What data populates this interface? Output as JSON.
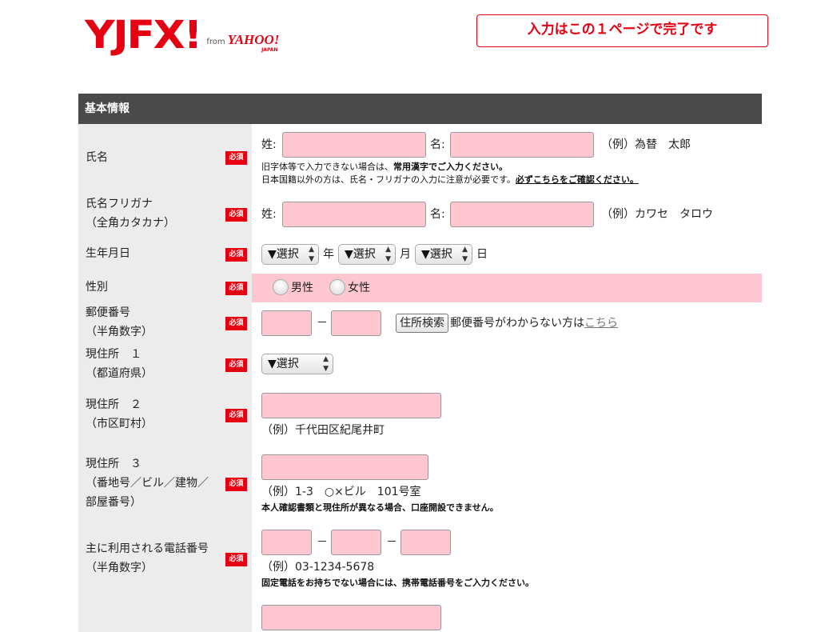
{
  "header": {
    "logo_text": "YJFX!",
    "logo_from": "from",
    "logo_yahoo": "YAHOO!",
    "logo_japan": "JAPAN",
    "banner": "入力はこの１ページで完了です"
  },
  "section_title": "基本情報",
  "required_badge": "必須",
  "fields": {
    "name": {
      "label": "氏名",
      "last_prefix": "姓:",
      "first_prefix": "名:",
      "example": "（例）為替　太郎",
      "note1_plain": "旧字体等で入力できない場合は、",
      "note1_bold": "常用漢字でご入力ください。",
      "note2_plain": "日本国籍以外の方は、氏名・フリガナの入力に注意が必要です。",
      "note2_link": "必ずこちらをご確認ください。"
    },
    "furigana": {
      "label1": "氏名フリガナ",
      "label2": "（全角カタカナ）",
      "last_prefix": "姓:",
      "first_prefix": "名:",
      "example": "（例）カワセ　タロウ"
    },
    "birthdate": {
      "label": "生年月日",
      "year_select": "▼選択",
      "year_unit": "年",
      "month_select": "▼選択",
      "month_unit": "月",
      "day_select": "▼選択",
      "day_unit": "日"
    },
    "gender": {
      "label": "性別",
      "male": "男性",
      "female": "女性"
    },
    "postal": {
      "label1": "郵便番号",
      "label2": "（半角数字）",
      "dash": "－",
      "search_button": "住所検索",
      "help_text": "郵便番号がわからない方は",
      "help_link": "こちら"
    },
    "address1": {
      "label1": "現住所　１",
      "label2": "（都道府県）",
      "select": "▼選択"
    },
    "address2": {
      "label1": "現住所　２",
      "label2": "（市区町村）",
      "example": "（例）千代田区紀尾井町"
    },
    "address3": {
      "label1": "現住所　３",
      "label2": "（番地号／ビル／建物／",
      "label3": "部屋番号）",
      "example": "（例）1-3　○×ビル　101号室",
      "note": "本人確認書類と現住所が異なる場合、口座開設できません。"
    },
    "phone": {
      "label1": "主に利用される電話番号",
      "label2": "（半角数字）",
      "dash": "－",
      "example": "（例）03-1234-5678",
      "note": "固定電話をお持ちでない場合には、携帯電話番号をご入力ください。"
    }
  },
  "colors": {
    "brand_red": "#e60012",
    "input_pink": "#ffc7d2",
    "section_gray": "#4a4a4a",
    "label_bg": "#ececec"
  }
}
